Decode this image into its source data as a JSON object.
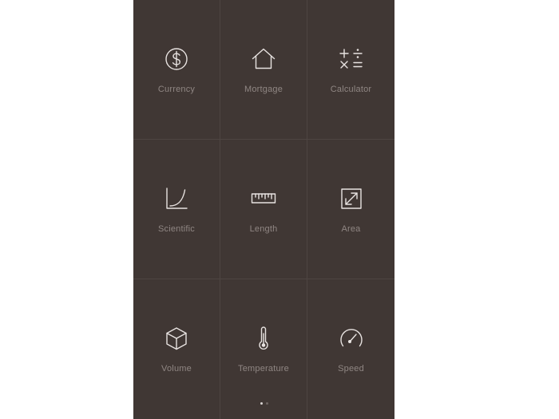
{
  "tiles": [
    {
      "label": "Currency",
      "icon": "dollar-circle-icon"
    },
    {
      "label": "Mortgage",
      "icon": "house-icon"
    },
    {
      "label": "Calculator",
      "icon": "calculator-operators-icon"
    },
    {
      "label": "Scientific",
      "icon": "curve-graph-icon"
    },
    {
      "label": "Length",
      "icon": "ruler-icon"
    },
    {
      "label": "Area",
      "icon": "expand-arrows-icon"
    },
    {
      "label": "Volume",
      "icon": "cube-icon"
    },
    {
      "label": "Temperature",
      "icon": "thermometer-icon"
    },
    {
      "label": "Speed",
      "icon": "speedometer-icon"
    }
  ],
  "pager": {
    "pages": 2,
    "current": 1
  },
  "colors": {
    "background": "#403734",
    "icon": "#e8e3e1",
    "label": "#8f8683",
    "divider": "#4e4542",
    "dot_active": "#d9d4d2",
    "dot_inactive": "#6e6562"
  }
}
